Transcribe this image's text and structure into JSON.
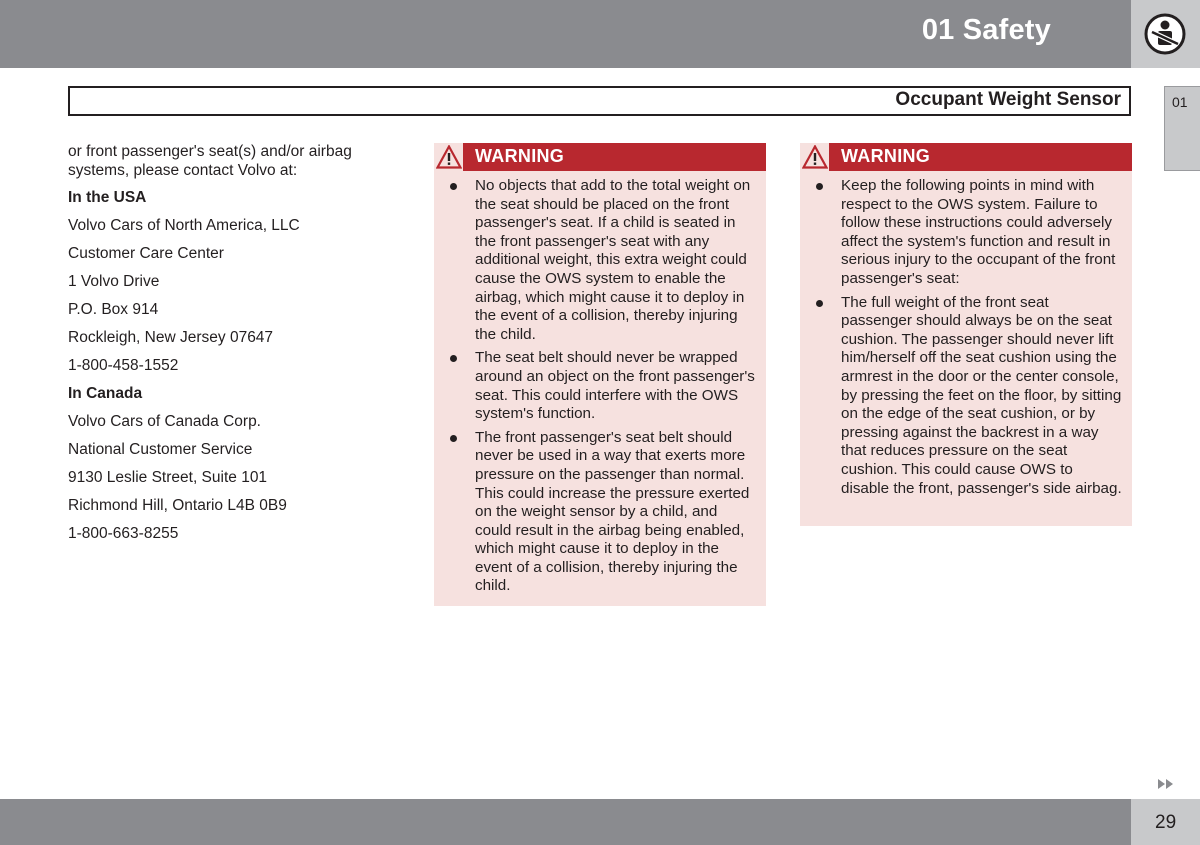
{
  "header": {
    "chapter_title": "01 Safety",
    "chapter_icon": "seatbelt-prohibited-icon",
    "section_title": "Occupant Weight Sensor",
    "side_tab_label": "01"
  },
  "contact": {
    "intro": "or front passenger's seat(s) and/or airbag systems, please contact Volvo at:",
    "usa": {
      "heading": "In the USA",
      "lines": [
        "Volvo Cars of North America, LLC",
        "Customer Care Center",
        "1 Volvo Drive",
        "P.O. Box 914",
        "Rockleigh, New Jersey 07647",
        "1-800-458-1552"
      ]
    },
    "canada": {
      "heading": "In Canada",
      "lines": [
        "Volvo Cars of Canada Corp.",
        "National Customer Service",
        "9130 Leslie Street, Suite 101",
        "Richmond Hill, Ontario L4B 0B9",
        "1-800-663-8255"
      ]
    }
  },
  "warnings": [
    {
      "title": "WARNING",
      "icon": "warning-triangle-icon",
      "items": [
        "No objects that add to the total weight on the seat should be placed on the front passenger's seat. If a child is seated in the front passenger's seat with any additional weight, this extra weight could cause the OWS system to enable the airbag, which might cause it to deploy in the event of a collision, thereby injuring the child.",
        "The seat belt should never be wrapped around an object on the front passenger's seat. This could interfere with the OWS system's function.",
        "The front passenger's seat belt should never be used in a way that exerts more pressure on the passenger than normal. This could increase the pressure exerted on the weight sensor by a child, and could result in the airbag being enabled, which might cause it to deploy in the event of a collision, thereby injuring the child."
      ]
    },
    {
      "title": "WARNING",
      "icon": "warning-triangle-icon",
      "items": [
        "Keep the following points in mind with respect to the OWS system. Failure to follow these instructions could adversely affect the system's function and result in serious injury to the occupant of the front passenger's seat:",
        "The full weight of the front seat passenger should always be on the seat cushion. The passenger should never lift him/herself off the seat cushion using the armrest in the door or the center console, by pressing the feet on the floor, by sitting on the edge of the seat cushion, or by pressing against the backrest in a way that reduces pressure on the seat cushion. This could cause OWS to disable the front, passenger's side airbag."
      ]
    }
  ],
  "footer": {
    "page_number": "29",
    "next_icon": "continue-arrows-icon"
  },
  "colors": {
    "header_gray": "#8a8b8f",
    "light_gray": "#c8c9cb",
    "warning_red": "#b8282f",
    "warning_bg": "#f6e1df"
  }
}
